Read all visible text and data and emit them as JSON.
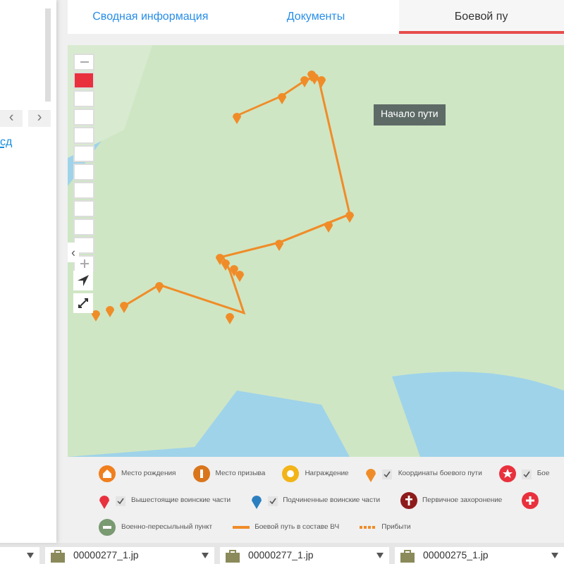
{
  "left_panel": {
    "pager": [
      "‹",
      "›"
    ],
    "link": "сд"
  },
  "tabs": [
    {
      "label": "Сводная информация",
      "selected": false
    },
    {
      "label": "Документы",
      "selected": false
    },
    {
      "label": "Боевой пу",
      "selected": true
    }
  ],
  "map": {
    "layers": [
      {
        "selected": true
      },
      {
        "selected": false
      },
      {
        "selected": false
      },
      {
        "selected": false
      },
      {
        "selected": false
      },
      {
        "selected": false
      },
      {
        "selected": false
      },
      {
        "selected": false
      },
      {
        "selected": false
      },
      {
        "selected": false
      }
    ],
    "collapse": "‹",
    "tooltip": "Начало пути"
  },
  "legend_rows": [
    [
      {
        "kind": "home",
        "label": "Место рождения",
        "color": "#f07f1e"
      },
      {
        "kind": "person",
        "label": "Место призыва",
        "color": "#d9761c"
      },
      {
        "kind": "medal",
        "label": "Награждение",
        "color": "#f2b418"
      },
      {
        "kind": "pin",
        "label": "Координаты боевого пути",
        "color": "#f08c28",
        "checked": true
      },
      {
        "kind": "star",
        "label": "Бое",
        "color": "#e8313d",
        "checked": true
      }
    ],
    [
      {
        "kind": "pin",
        "label": "Вышестоящие воинские части",
        "color": "#e8313d",
        "checked": true
      },
      {
        "kind": "pin",
        "label": "Подчиненные воинские части",
        "color": "#2b7fc0",
        "checked": true
      },
      {
        "kind": "cross",
        "label": "Первичное захоронение",
        "color": "#8e1b1b"
      },
      {
        "kind": "plus",
        "color": "#e8313d"
      }
    ],
    [
      {
        "kind": "dot",
        "label": "Военно-пересыльный пункт",
        "color": "#7a9a72"
      },
      {
        "kind": "line",
        "label": "Боевой путь в составе ВЧ",
        "color": "#f08c28"
      },
      {
        "kind": "dashed",
        "label": "Прибыти",
        "color": "#f08c28"
      }
    ]
  ],
  "files": [
    {
      "kind": "partial"
    },
    {
      "kind": "file",
      "name": "00000277_1.jp"
    },
    {
      "kind": "file",
      "name": "00000277_1.jp"
    },
    {
      "kind": "file",
      "name": "00000275_1.jp"
    }
  ]
}
